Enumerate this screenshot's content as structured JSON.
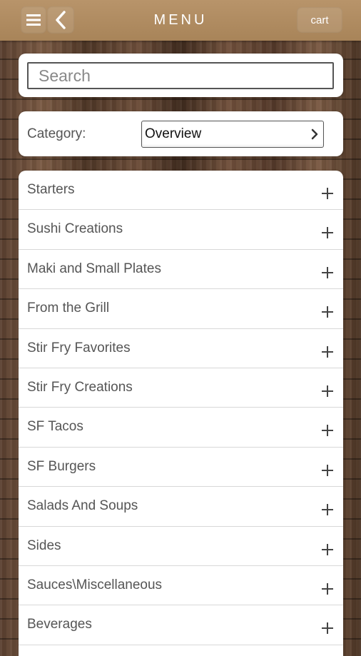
{
  "header": {
    "title": "MENU",
    "cart_label": "cart",
    "menu_icon": "hamburger-icon",
    "back_icon": "chevron-left-icon"
  },
  "search": {
    "placeholder": "Search",
    "value": ""
  },
  "category": {
    "label": "Category:",
    "selected": "Overview",
    "chevron_icon": "chevron-right-icon"
  },
  "menu_categories": [
    {
      "label": "Starters"
    },
    {
      "label": "Sushi Creations"
    },
    {
      "label": "Maki and Small Plates"
    },
    {
      "label": "From the Grill"
    },
    {
      "label": "Stir Fry Favorites"
    },
    {
      "label": "Stir Fry Creations"
    },
    {
      "label": "SF Tacos"
    },
    {
      "label": "SF Burgers"
    },
    {
      "label": "Salads And Soups"
    },
    {
      "label": "Sides"
    },
    {
      "label": "Sauces\\Miscellaneous"
    },
    {
      "label": "Beverages"
    }
  ],
  "colors": {
    "header_bg": "#b8946a",
    "text_primary": "#555555",
    "card_bg": "#ffffff"
  }
}
